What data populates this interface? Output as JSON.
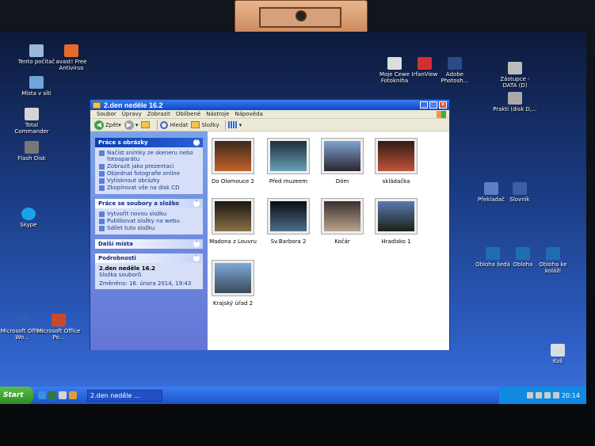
{
  "window": {
    "title": "2.den neděle 16.2"
  },
  "menu": [
    "Soubor",
    "Úpravy",
    "Zobrazit",
    "Oblíbené",
    "Nástroje",
    "Nápověda"
  ],
  "toolbar": {
    "back": "Zpět",
    "search": "Hledat",
    "folders": "Složky"
  },
  "panel_images": {
    "title": "Práce s obrázky",
    "items": [
      "Načíst snímky ze skeneru nebo fotoaparátu",
      "Zobrazit jako prezentaci",
      "Objednat fotografie online",
      "Vytisknout obrázky",
      "Zkopírovat vše na disk CD"
    ]
  },
  "panel_files": {
    "title": "Práce se soubory a složko",
    "items": [
      "Vytvořit novou složku",
      "Publikovat složky na webu",
      "Sdílet tuto složku"
    ]
  },
  "panel_places": {
    "title": "Další místa"
  },
  "panel_details": {
    "title": "Podrobnosti",
    "name": "2.den neděle 16.2",
    "type": "Složka souborů",
    "modified": "Změněno: 16. února 2014, 19:43"
  },
  "thumbs": [
    {
      "label": "Do Olomouce 2",
      "c1": "#3a2a1a",
      "c2": "#c4602a"
    },
    {
      "label": "Před muzeem",
      "c1": "#1d2f3a",
      "c2": "#6aa1b8"
    },
    {
      "label": "Dóm",
      "c1": "#7fa3cf",
      "c2": "#2a2530"
    },
    {
      "label": "skládačka",
      "c1": "#301a14",
      "c2": "#c0543a"
    },
    {
      "label": "Madona z Louvru",
      "c1": "#1a1612",
      "c2": "#8a7046"
    },
    {
      "label": "Sv.Barbora 2",
      "c1": "#0a0c10",
      "c2": "#4c6f8a"
    },
    {
      "label": "Kočár",
      "c1": "#3a3030",
      "c2": "#b9a38c"
    },
    {
      "label": "Hradisko 1",
      "c1": "#5a7bb0",
      "c2": "#1a2016"
    },
    {
      "label": "Krajský úřad 2",
      "c1": "#7ca9d8",
      "c2": "#3b4a58"
    }
  ],
  "desktop_left": [
    "Tento počítač",
    "avast! Free Antivirus",
    "Místa v síti",
    "Total Commander",
    "Flash Disk",
    "Skype",
    "Microsoft Office Wo...",
    "Microsoft Office Po..."
  ],
  "desktop_right": [
    "Moje Cewe Fotokniha",
    "IrfanView",
    "Adobe Photosh...",
    "Zástupce - DATA (D)",
    "Prakti (disk D,...",
    "Překladač",
    "Slovník",
    "Obloha šedá",
    "Obloha",
    "Obloha ke koláži",
    "Koš"
  ],
  "taskbar": {
    "start": "Start",
    "task": "2.den neděle ...",
    "time": "20:14"
  }
}
